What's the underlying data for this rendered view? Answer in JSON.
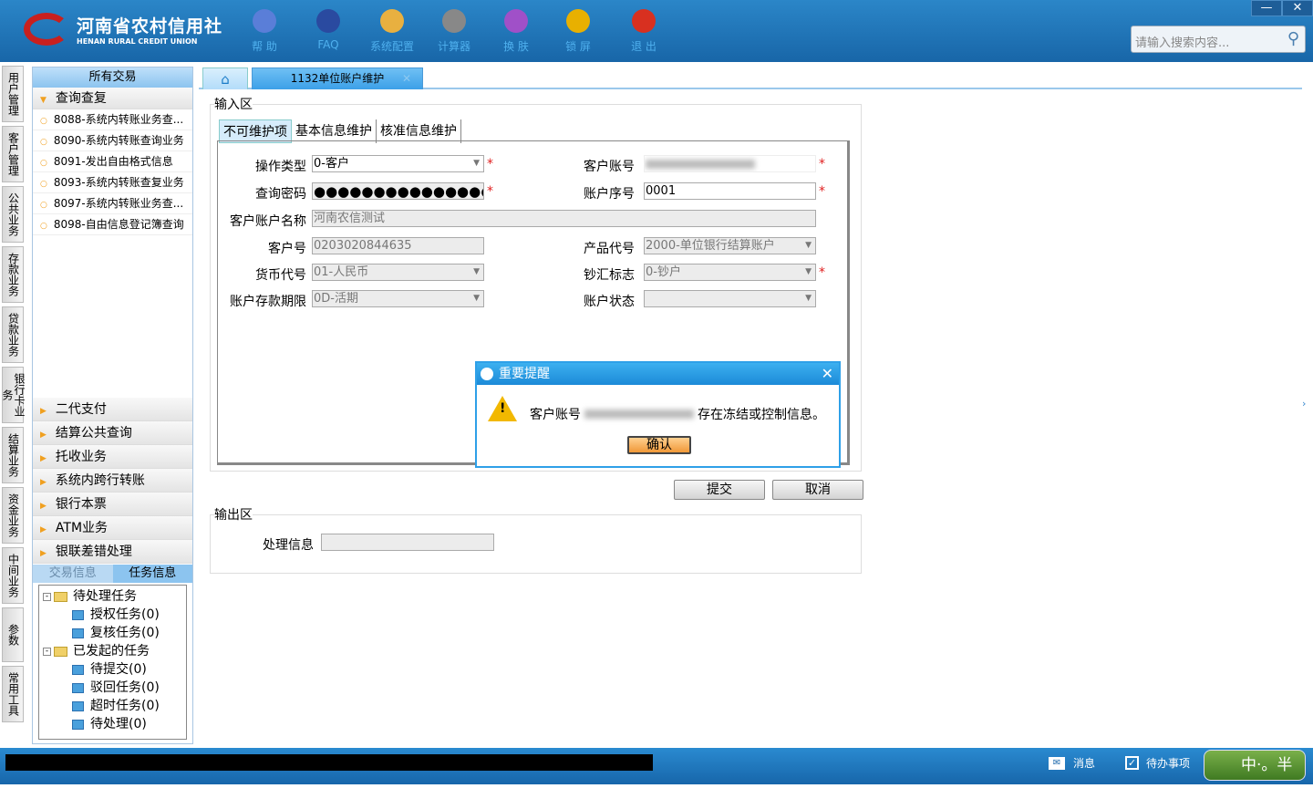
{
  "header": {
    "logo_cn": "河南省农村信用社",
    "logo_en": "HENAN RURAL CREDIT UNION",
    "tools": [
      {
        "label": "帮 助",
        "icon": "info-icon",
        "color": "#5a7ed8"
      },
      {
        "label": "FAQ",
        "icon": "question-icon",
        "color": "#2a4aa0"
      },
      {
        "label": "系统配置",
        "icon": "toolbox-icon",
        "color": "#e8b040"
      },
      {
        "label": "计算器",
        "icon": "calculator-icon",
        "color": "#888888"
      },
      {
        "label": "换 肤",
        "icon": "shirt-icon",
        "color": "#a050c8"
      },
      {
        "label": "锁 屏",
        "icon": "lock-icon",
        "color": "#e8b000"
      },
      {
        "label": "退 出",
        "icon": "power-icon",
        "color": "#d83020"
      }
    ],
    "search_placeholder": "请输入搜索内容..."
  },
  "vtabs": [
    "用户管理",
    "客户管理",
    "公共业务",
    "存款业务",
    "贷款业务",
    "银行卡业务",
    "结算业务",
    "资金业务",
    "中间业务",
    "参数",
    "常用工具"
  ],
  "sidebar": {
    "title": "所有交易",
    "open_group": "查询查复",
    "items": [
      "8088-系统内转账业务查...",
      "8090-系统内转账查询业务",
      "8091-发出自由格式信息",
      "8093-系统内转账查复业务",
      "8097-系统内转账业务查...",
      "8098-自由信息登记簿查询"
    ],
    "groups": [
      "二代支付",
      "结算公共查询",
      "托收业务",
      "系统内跨行转账",
      "银行本票",
      "ATM业务",
      "银联差错处理"
    ],
    "subtabs": [
      "交易信息",
      "任务信息"
    ],
    "tree": [
      {
        "label": "待处理任务",
        "level": 0
      },
      {
        "label": "授权任务(0)",
        "level": 1
      },
      {
        "label": "复核任务(0)",
        "level": 1
      },
      {
        "label": "已发起的任务",
        "level": 0
      },
      {
        "label": "待提交(0)",
        "level": 1
      },
      {
        "label": "驳回任务(0)",
        "level": 1
      },
      {
        "label": "超时任务(0)",
        "level": 1
      },
      {
        "label": "待处理(0)",
        "level": 1
      }
    ]
  },
  "main": {
    "tab": "1132单位账户维护",
    "input_area": "输入区",
    "output_area": "输出区",
    "inner_tabs": [
      "不可维护项",
      "基本信息维护",
      "核准信息维护"
    ],
    "fields": {
      "op_type_label": "操作类型",
      "op_type": "0-客户",
      "acct_label": "客户账号",
      "pwd_label": "查询密码",
      "pwd": "●●●●●●●●●●●●●●●",
      "seq_label": "账户序号",
      "seq": "0001",
      "name_label": "客户账户名称",
      "name": "河南农信测试",
      "cust_no_label": "客户号",
      "cust_no": "0203020844635",
      "product_label": "产品代号",
      "product": "2000-单位银行结算账户",
      "currency_label": "货币代号",
      "currency": "01-人民币",
      "cash_label": "钞汇标志",
      "cash": "0-钞户",
      "term_label": "账户存款期限",
      "term": "0D-活期",
      "status_label": "账户状态",
      "status": ""
    },
    "submit": "提交",
    "cancel": "取消",
    "proc_label": "处理信息",
    "proc": ""
  },
  "dialog": {
    "title": "重要提醒",
    "msg_prefix": "客户账号",
    "msg_suffix": "存在冻结或控制信息。",
    "ok": "确认"
  },
  "statusbar": {
    "msg": "消息",
    "todo": "待办事项",
    "ime": "中·。半简"
  }
}
